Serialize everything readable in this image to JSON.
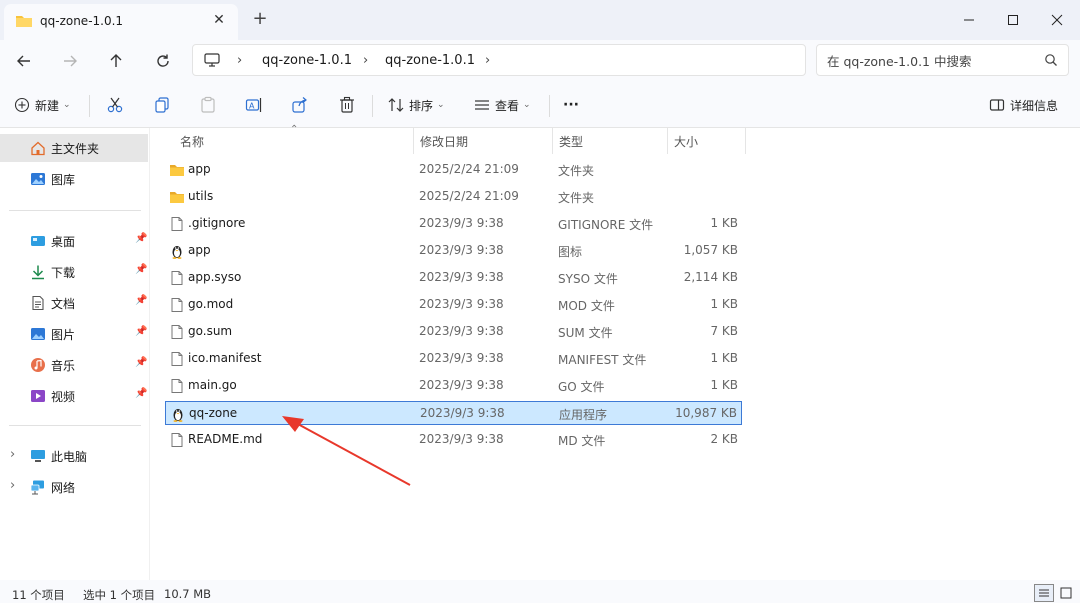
{
  "window": {
    "tab_title": "qq-zone-1.0.1",
    "new_tab": "+",
    "minimize": "—",
    "maximize": "☐",
    "close": "✕"
  },
  "address": {
    "crumbs": [
      "qq-zone-1.0.1",
      "qq-zone-1.0.1"
    ],
    "search_placeholder": "在 qq-zone-1.0.1 中搜索"
  },
  "toolbar": {
    "new_label": "新建",
    "sort_label": "排序",
    "view_label": "查看",
    "more_label": "···",
    "details_label": "详细信息"
  },
  "sidebar": {
    "home": "主文件夹",
    "gallery": "图库",
    "pinned": [
      {
        "label": "桌面",
        "icon": "desktop-icon"
      },
      {
        "label": "下载",
        "icon": "download-icon"
      },
      {
        "label": "文档",
        "icon": "documents-icon"
      },
      {
        "label": "图片",
        "icon": "pictures-icon"
      },
      {
        "label": "音乐",
        "icon": "music-icon"
      },
      {
        "label": "视频",
        "icon": "videos-icon"
      }
    ],
    "this_pc": "此电脑",
    "network": "网络"
  },
  "columns": {
    "name": "名称",
    "date": "修改日期",
    "type": "类型",
    "size": "大小"
  },
  "files": [
    {
      "name": "app",
      "date": "2025/2/24 21:09",
      "type": "文件夹",
      "size": "",
      "icon": "folder-icon"
    },
    {
      "name": "utils",
      "date": "2025/2/24 21:09",
      "type": "文件夹",
      "size": "",
      "icon": "folder-icon"
    },
    {
      "name": ".gitignore",
      "date": "2023/9/3 9:38",
      "type": "GITIGNORE 文件",
      "size": "1 KB",
      "icon": "file-icon"
    },
    {
      "name": "app",
      "date": "2023/9/3 9:38",
      "type": "图标",
      "size": "1,057 KB",
      "icon": "penguin-icon"
    },
    {
      "name": "app.syso",
      "date": "2023/9/3 9:38",
      "type": "SYSO 文件",
      "size": "2,114 KB",
      "icon": "file-icon"
    },
    {
      "name": "go.mod",
      "date": "2023/9/3 9:38",
      "type": "MOD 文件",
      "size": "1 KB",
      "icon": "file-icon"
    },
    {
      "name": "go.sum",
      "date": "2023/9/3 9:38",
      "type": "SUM 文件",
      "size": "7 KB",
      "icon": "file-icon"
    },
    {
      "name": "ico.manifest",
      "date": "2023/9/3 9:38",
      "type": "MANIFEST 文件",
      "size": "1 KB",
      "icon": "file-icon"
    },
    {
      "name": "main.go",
      "date": "2023/9/3 9:38",
      "type": "GO 文件",
      "size": "1 KB",
      "icon": "file-icon"
    },
    {
      "name": "qq-zone",
      "date": "2023/9/3 9:38",
      "type": "应用程序",
      "size": "10,987 KB",
      "icon": "penguin-icon",
      "selected": true
    },
    {
      "name": "README.md",
      "date": "2023/9/3 9:38",
      "type": "MD 文件",
      "size": "2 KB",
      "icon": "file-icon"
    }
  ],
  "status": {
    "count": "11 个项目",
    "selection": "选中 1 个项目",
    "size": "10.7 MB"
  },
  "colors": {
    "accent": "#3d7ad6",
    "selection_bg": "#cce8ff",
    "annotation_arrow": "#e8382b",
    "folder": "#f8c33c"
  }
}
